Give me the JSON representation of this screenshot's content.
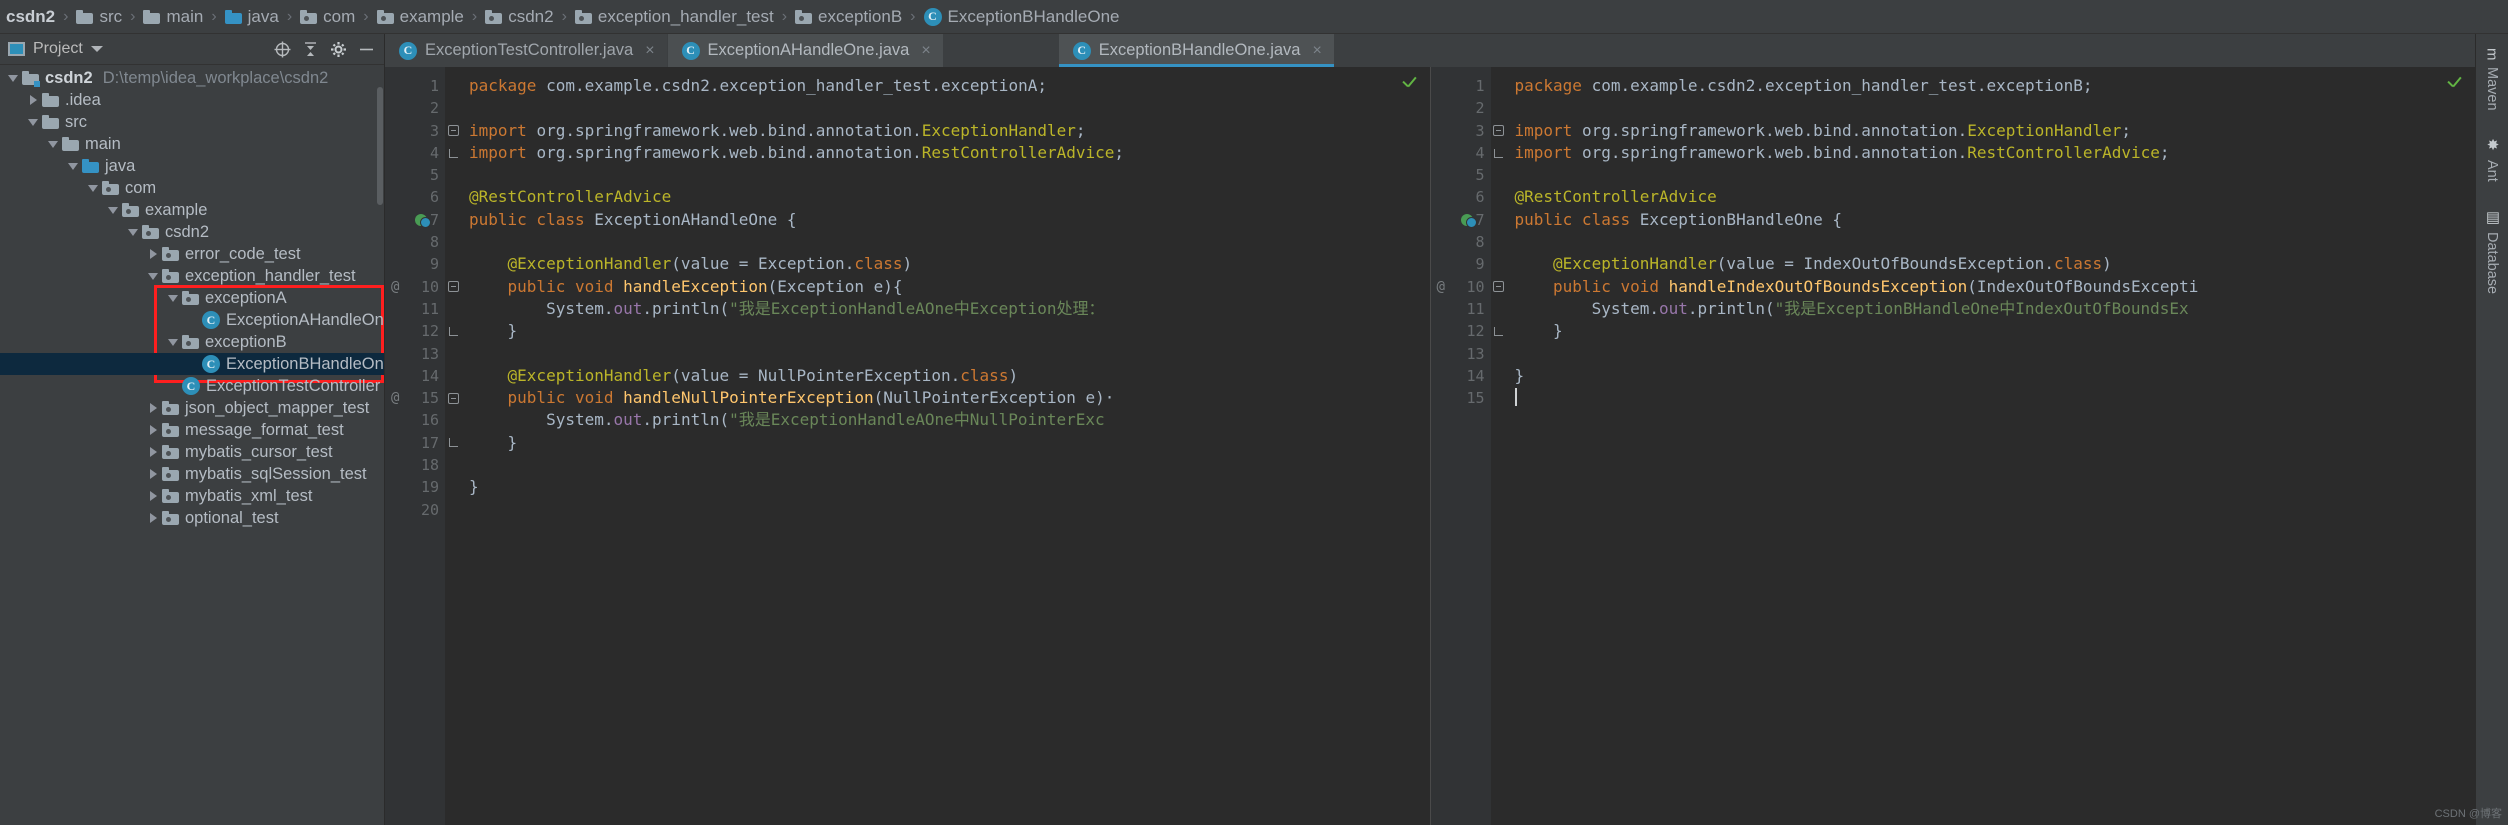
{
  "breadcrumb": [
    {
      "label": "csdn2",
      "icon": "none",
      "bold": true
    },
    {
      "label": "src",
      "icon": "folder"
    },
    {
      "label": "main",
      "icon": "folder"
    },
    {
      "label": "java",
      "icon": "source-folder"
    },
    {
      "label": "com",
      "icon": "package"
    },
    {
      "label": "example",
      "icon": "package"
    },
    {
      "label": "csdn2",
      "icon": "package"
    },
    {
      "label": "exception_handler_test",
      "icon": "package"
    },
    {
      "label": "exceptionB",
      "icon": "package"
    },
    {
      "label": "ExceptionBHandleOne",
      "icon": "class"
    }
  ],
  "sidebar": {
    "title": "Project",
    "header_icons": [
      "locate-icon",
      "collapse-all-icon",
      "settings-gear-icon",
      "hide-icon"
    ],
    "tree": [
      {
        "label": "csdn2",
        "path": "D:\\temp\\idea_workplace\\csdn2",
        "indent": 0,
        "arrow": "open",
        "icon": "module",
        "bold": true
      },
      {
        "label": ".idea",
        "indent": 1,
        "arrow": "closed",
        "icon": "folder"
      },
      {
        "label": "src",
        "indent": 1,
        "arrow": "open",
        "icon": "folder"
      },
      {
        "label": "main",
        "indent": 2,
        "arrow": "open",
        "icon": "folder"
      },
      {
        "label": "java",
        "indent": 3,
        "arrow": "open",
        "icon": "source-folder"
      },
      {
        "label": "com",
        "indent": 4,
        "arrow": "open",
        "icon": "package"
      },
      {
        "label": "example",
        "indent": 5,
        "arrow": "open",
        "icon": "package"
      },
      {
        "label": "csdn2",
        "indent": 6,
        "arrow": "open",
        "icon": "package"
      },
      {
        "label": "error_code_test",
        "indent": 7,
        "arrow": "closed",
        "icon": "package"
      },
      {
        "label": "exception_handler_test",
        "indent": 7,
        "arrow": "open",
        "icon": "package"
      },
      {
        "label": "exceptionA",
        "indent": 8,
        "arrow": "open",
        "icon": "package"
      },
      {
        "label": "ExceptionAHandleOne",
        "indent": 9,
        "arrow": "none",
        "icon": "class"
      },
      {
        "label": "exceptionB",
        "indent": 8,
        "arrow": "open",
        "icon": "package"
      },
      {
        "label": "ExceptionBHandleOne",
        "indent": 9,
        "arrow": "none",
        "icon": "class",
        "selected": true
      },
      {
        "label": "ExceptionTestController",
        "indent": 8,
        "arrow": "none",
        "icon": "class"
      },
      {
        "label": "json_object_mapper_test",
        "indent": 7,
        "arrow": "closed",
        "icon": "package"
      },
      {
        "label": "message_format_test",
        "indent": 7,
        "arrow": "closed",
        "icon": "package"
      },
      {
        "label": "mybatis_cursor_test",
        "indent": 7,
        "arrow": "closed",
        "icon": "package"
      },
      {
        "label": "mybatis_sqlSession_test",
        "indent": 7,
        "arrow": "closed",
        "icon": "package"
      },
      {
        "label": "mybatis_xml_test",
        "indent": 7,
        "arrow": "closed",
        "icon": "package"
      },
      {
        "label": "optional_test",
        "indent": 7,
        "arrow": "closed",
        "icon": "package"
      }
    ]
  },
  "tabs": [
    {
      "label": "ExceptionTestController.java",
      "state": "inactive",
      "icon": "class",
      "close": "×"
    },
    {
      "label": "ExceptionAHandleOne.java",
      "state": "inactive",
      "icon": "class",
      "close": "×"
    },
    {
      "label": "ExceptionBHandleOne.java",
      "state": "active",
      "icon": "class",
      "close": "×"
    }
  ],
  "editors": [
    {
      "name": "ExceptionAHandleOne.java",
      "lines": [
        {
          "n": "1",
          "fold": "none",
          "tokens": [
            {
              "t": "package ",
              "c": "kw"
            },
            {
              "t": "com.example.csdn2.exception_handler_test.exceptionA;",
              "c": "id"
            }
          ]
        },
        {
          "n": "2",
          "fold": "none",
          "tokens": []
        },
        {
          "n": "3",
          "fold": "fold-start",
          "tokens": [
            {
              "t": "import ",
              "c": "kw"
            },
            {
              "t": "org.springframework.web.bind.annotation.",
              "c": "id"
            },
            {
              "t": "ExceptionHandler",
              "c": "ann"
            },
            {
              "t": ";",
              "c": "id"
            }
          ]
        },
        {
          "n": "4",
          "fold": "fold-end",
          "tokens": [
            {
              "t": "import ",
              "c": "kw"
            },
            {
              "t": "org.springframework.web.bind.annotation.",
              "c": "id"
            },
            {
              "t": "RestControllerAdvice",
              "c": "ann"
            },
            {
              "t": ";",
              "c": "id"
            }
          ]
        },
        {
          "n": "5",
          "fold": "none",
          "tokens": []
        },
        {
          "n": "6",
          "fold": "none",
          "tokens": [
            {
              "t": "@RestControllerAdvice",
              "c": "ann"
            }
          ]
        },
        {
          "n": "7",
          "fold": "none",
          "gutter": "run-class",
          "tokens": [
            {
              "t": "public class ",
              "c": "kw"
            },
            {
              "t": "ExceptionAHandleOne ",
              "c": "id"
            },
            {
              "t": "{",
              "c": "pln"
            }
          ]
        },
        {
          "n": "8",
          "fold": "none",
          "tokens": []
        },
        {
          "n": "9",
          "fold": "none",
          "tokens": [
            {
              "t": "    @ExceptionHandler",
              "c": "ann"
            },
            {
              "t": "(value = Exception.",
              "c": "pln"
            },
            {
              "t": "class",
              "c": "kw"
            },
            {
              "t": ")",
              "c": "pln"
            }
          ]
        },
        {
          "n": "10",
          "fold": "brace-open",
          "mark": "@",
          "tokens": [
            {
              "t": "    ",
              "c": "pln"
            },
            {
              "t": "public void ",
              "c": "kw"
            },
            {
              "t": "handleException",
              "c": "mth"
            },
            {
              "t": "(Exception e){",
              "c": "pln"
            }
          ]
        },
        {
          "n": "11",
          "fold": "none",
          "tokens": [
            {
              "t": "        System.",
              "c": "pln"
            },
            {
              "t": "out",
              "c": "fld"
            },
            {
              "t": ".println(",
              "c": "pln"
            },
            {
              "t": "\"我是ExceptionHandleAOne中Exception处理：",
              "c": "str"
            }
          ]
        },
        {
          "n": "12",
          "fold": "brace-close",
          "tokens": [
            {
              "t": "    }",
              "c": "pln"
            }
          ]
        },
        {
          "n": "13",
          "fold": "none",
          "tokens": []
        },
        {
          "n": "14",
          "fold": "none",
          "tokens": [
            {
              "t": "    @ExceptionHandler",
              "c": "ann"
            },
            {
              "t": "(value = NullPointerException.",
              "c": "pln"
            },
            {
              "t": "class",
              "c": "kw"
            },
            {
              "t": ")",
              "c": "pln"
            }
          ]
        },
        {
          "n": "15",
          "fold": "brace-open",
          "mark": "@",
          "tokens": [
            {
              "t": "    ",
              "c": "pln"
            },
            {
              "t": "public void ",
              "c": "kw"
            },
            {
              "t": "handleNullPointerException",
              "c": "mth"
            },
            {
              "t": "(NullPointerException e)·",
              "c": "pln"
            }
          ]
        },
        {
          "n": "16",
          "fold": "none",
          "tokens": [
            {
              "t": "        System.",
              "c": "pln"
            },
            {
              "t": "out",
              "c": "fld"
            },
            {
              "t": ".println(",
              "c": "pln"
            },
            {
              "t": "\"我是ExceptionHandleAOne中NullPointerExc",
              "c": "str"
            }
          ]
        },
        {
          "n": "17",
          "fold": "brace-close",
          "tokens": [
            {
              "t": "    }",
              "c": "pln"
            }
          ]
        },
        {
          "n": "18",
          "fold": "none",
          "tokens": []
        },
        {
          "n": "19",
          "fold": "none",
          "tokens": [
            {
              "t": "}",
              "c": "pln"
            }
          ]
        },
        {
          "n": "20",
          "fold": "none",
          "tokens": []
        }
      ]
    },
    {
      "name": "ExceptionBHandleOne.java",
      "lines": [
        {
          "n": "1",
          "fold": "none",
          "tokens": [
            {
              "t": "package ",
              "c": "kw"
            },
            {
              "t": "com.example.csdn2.exception_handler_test.exceptionB;",
              "c": "id"
            }
          ]
        },
        {
          "n": "2",
          "fold": "none",
          "tokens": []
        },
        {
          "n": "3",
          "fold": "fold-start",
          "tokens": [
            {
              "t": "import ",
              "c": "kw"
            },
            {
              "t": "org.springframework.web.bind.annotation.",
              "c": "id"
            },
            {
              "t": "ExceptionHandler",
              "c": "ann"
            },
            {
              "t": ";",
              "c": "id"
            }
          ]
        },
        {
          "n": "4",
          "fold": "fold-end",
          "tokens": [
            {
              "t": "import ",
              "c": "kw"
            },
            {
              "t": "org.springframework.web.bind.annotation.",
              "c": "id"
            },
            {
              "t": "RestControllerAdvice",
              "c": "ann"
            },
            {
              "t": ";",
              "c": "id"
            }
          ]
        },
        {
          "n": "5",
          "fold": "none",
          "tokens": []
        },
        {
          "n": "6",
          "fold": "none",
          "tokens": [
            {
              "t": "@RestControllerAdvice",
              "c": "ann"
            }
          ]
        },
        {
          "n": "7",
          "fold": "none",
          "gutter": "run-class",
          "tokens": [
            {
              "t": "public class ",
              "c": "kw"
            },
            {
              "t": "ExceptionBHandleOne ",
              "c": "id"
            },
            {
              "t": "{",
              "c": "pln"
            }
          ]
        },
        {
          "n": "8",
          "fold": "none",
          "tokens": []
        },
        {
          "n": "9",
          "fold": "none",
          "tokens": [
            {
              "t": "    @ExceptionHandler",
              "c": "ann"
            },
            {
              "t": "(value = IndexOutOfBoundsException.",
              "c": "pln"
            },
            {
              "t": "class",
              "c": "kw"
            },
            {
              "t": ")",
              "c": "pln"
            }
          ]
        },
        {
          "n": "10",
          "fold": "brace-open",
          "mark": "@",
          "tokens": [
            {
              "t": "    ",
              "c": "pln"
            },
            {
              "t": "public void ",
              "c": "kw"
            },
            {
              "t": "handleIndexOutOfBoundsException",
              "c": "mth"
            },
            {
              "t": "(IndexOutOfBoundsExcepti",
              "c": "pln"
            }
          ]
        },
        {
          "n": "11",
          "fold": "none",
          "tokens": [
            {
              "t": "        System.",
              "c": "pln"
            },
            {
              "t": "out",
              "c": "fld"
            },
            {
              "t": ".println(",
              "c": "pln"
            },
            {
              "t": "\"我是ExceptionBHandleOne中IndexOutOfBoundsEx",
              "c": "str"
            }
          ]
        },
        {
          "n": "12",
          "fold": "brace-close",
          "tokens": [
            {
              "t": "    }",
              "c": "pln"
            }
          ]
        },
        {
          "n": "13",
          "fold": "none",
          "tokens": []
        },
        {
          "n": "14",
          "fold": "none",
          "tokens": [
            {
              "t": "}",
              "c": "pln"
            }
          ]
        },
        {
          "n": "15",
          "fold": "none",
          "caret": true,
          "tokens": []
        }
      ]
    }
  ],
  "tool_windows": [
    {
      "label": "Maven",
      "icon": "m"
    },
    {
      "label": "Ant",
      "icon": "✸"
    },
    {
      "label": "Database",
      "icon": "▤"
    }
  ],
  "watermark": "CSDN @博客",
  "colors": {
    "accent": "#3592c4",
    "selection": "#0d293e",
    "highlight_box": "#ff1f1f",
    "editor_bg": "#2b2b2b",
    "panel_bg": "#3c3f41"
  }
}
